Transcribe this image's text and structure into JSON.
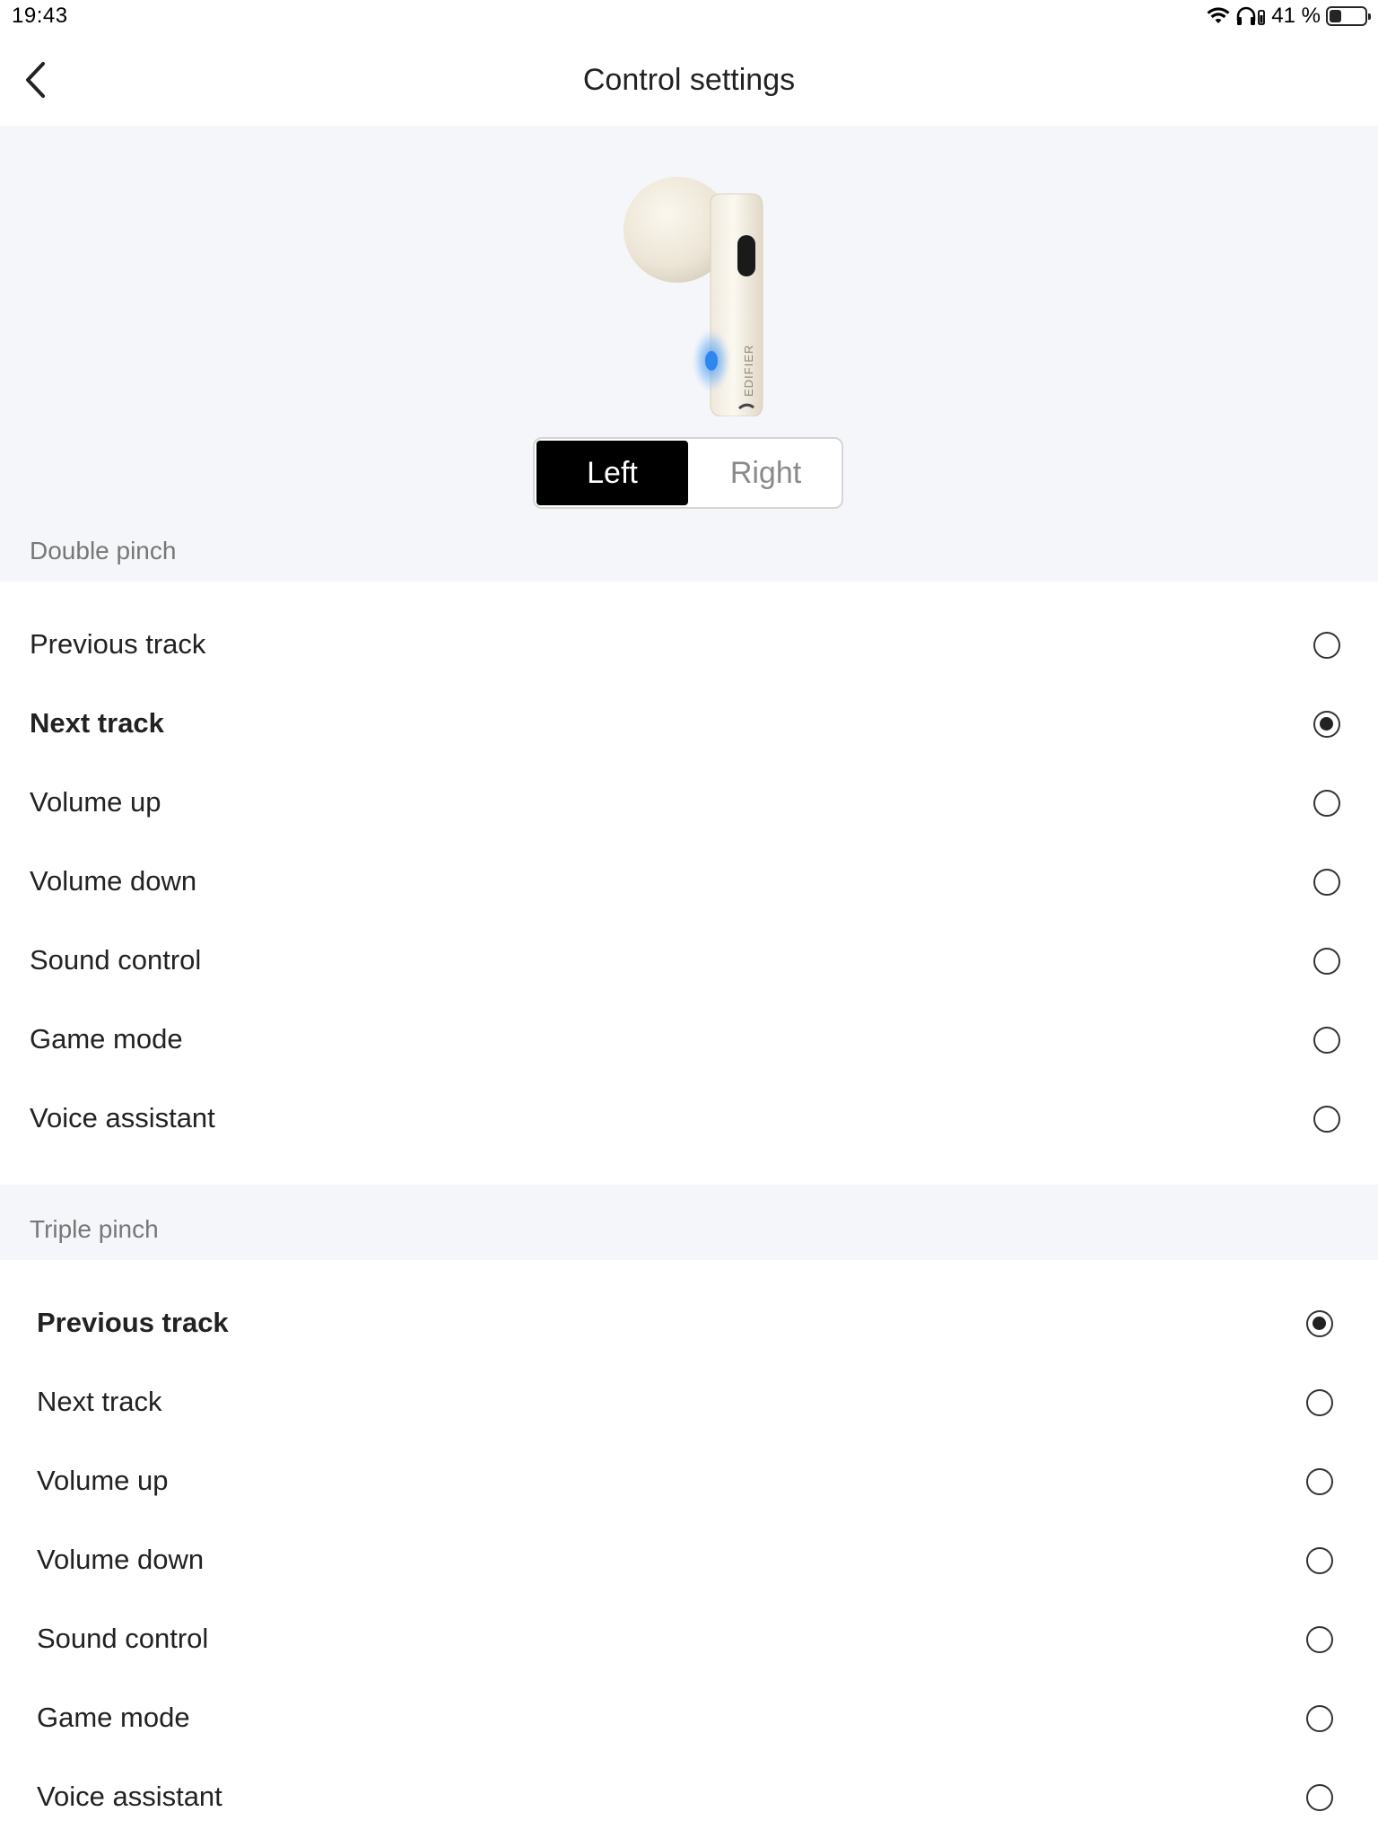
{
  "status_bar": {
    "time": "19:43",
    "battery_text": "41 %",
    "battery_level": 0.41,
    "icons": [
      "wifi-icon",
      "headphones-icon",
      "battery-icon"
    ]
  },
  "nav": {
    "title": "Control settings",
    "back_icon": "chevron-left-icon"
  },
  "device": {
    "image": "earbud-image",
    "brand_text": "EDIFIER",
    "sides": [
      "Left",
      "Right"
    ],
    "selected_side": "Left"
  },
  "double_pinch": {
    "header": "Double pinch",
    "options": [
      {
        "label": "Previous track",
        "selected": false
      },
      {
        "label": "Next track",
        "selected": true
      },
      {
        "label": "Volume up",
        "selected": false
      },
      {
        "label": "Volume down",
        "selected": false
      },
      {
        "label": "Sound control",
        "selected": false
      },
      {
        "label": "Game mode",
        "selected": false
      },
      {
        "label": "Voice assistant",
        "selected": false
      }
    ]
  },
  "triple_pinch": {
    "header": "Triple pinch",
    "options": [
      {
        "label": "Previous track",
        "selected": true
      },
      {
        "label": "Next track",
        "selected": false
      },
      {
        "label": "Volume up",
        "selected": false
      },
      {
        "label": "Volume down",
        "selected": false
      },
      {
        "label": "Sound control",
        "selected": false
      },
      {
        "label": "Game mode",
        "selected": false
      },
      {
        "label": "Voice assistant",
        "selected": false
      }
    ]
  },
  "colors": {
    "background": "#ffffff",
    "section_background": "#f5f6f9",
    "segment_active": "#000000",
    "touch_indicator": "#3a8ff0"
  }
}
